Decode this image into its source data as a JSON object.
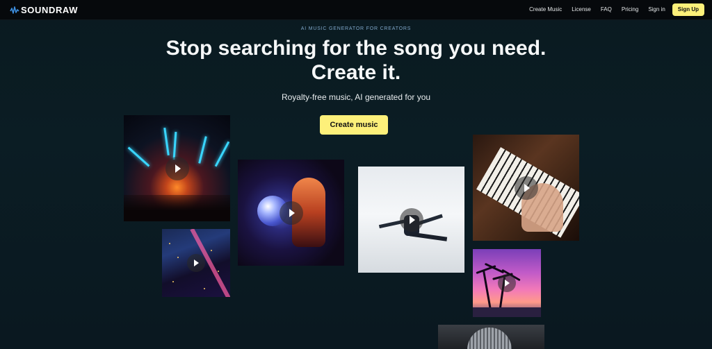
{
  "brand": {
    "name": "SOUNDRAW",
    "logo_icon": "soundwave-icon",
    "accent": "#fdf07a"
  },
  "nav": {
    "links": [
      "Create Music",
      "License",
      "FAQ",
      "Pricing",
      "Sign in"
    ],
    "signup_label": "Sign Up"
  },
  "hero": {
    "eyebrow": "AI MUSIC GENERATOR FOR CREATORS",
    "headline_line1": "Stop searching for the song you need.",
    "headline_line2": "Create it.",
    "subhead": "Royalty-free music, AI generated for you",
    "cta_label": "Create music"
  },
  "tiles": [
    {
      "name": "concert-lights",
      "icon": "play-icon"
    },
    {
      "name": "city-night",
      "icon": "play-icon"
    },
    {
      "name": "disco-ball",
      "icon": "play-icon"
    },
    {
      "name": "dancer",
      "icon": "play-icon"
    },
    {
      "name": "piano",
      "icon": "play-icon"
    },
    {
      "name": "palm-sunset",
      "icon": "play-icon"
    },
    {
      "name": "microphone",
      "icon": "none"
    }
  ]
}
